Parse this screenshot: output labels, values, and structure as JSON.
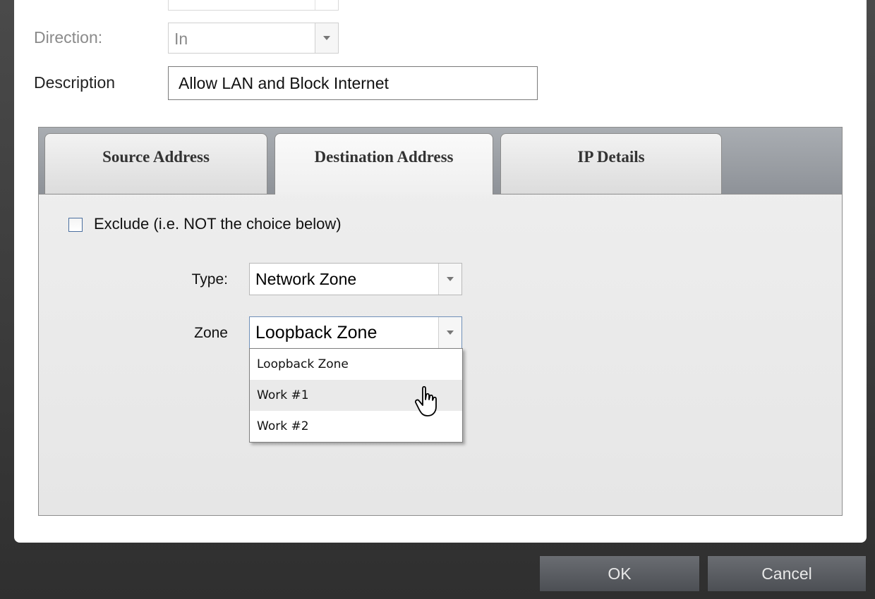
{
  "form": {
    "direction_label": "Direction:",
    "direction_value": "In",
    "description_label": "Description",
    "description_value": "Allow LAN and Block Internet"
  },
  "tabs": [
    {
      "label": "Source Address",
      "active": false
    },
    {
      "label": "Destination Address",
      "active": true
    },
    {
      "label": "IP Details",
      "active": false
    }
  ],
  "destination": {
    "exclude_label": "Exclude (i.e. NOT the choice below)",
    "exclude_checked": false,
    "type_label": "Type:",
    "type_value": "Network Zone",
    "zone_label": "Zone",
    "zone_value": "Loopback Zone",
    "zone_options": [
      "Loopback Zone",
      "Work #1",
      "Work #2"
    ],
    "zone_hovered": "Work #1"
  },
  "footer": {
    "ok_label": "OK",
    "cancel_label": "Cancel"
  },
  "icons": {
    "dropdown": "chevron-down-icon",
    "cursor": "hand-pointer-icon"
  }
}
